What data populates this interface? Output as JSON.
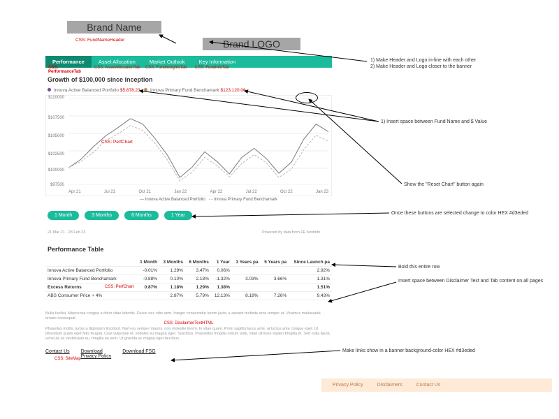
{
  "brand": {
    "name": "Brand Name",
    "logo": "Brand LOGO"
  },
  "css_labels": {
    "fundname": "CSS: FundNameHeader",
    "tab_perf": "CSS: PerformanceTab",
    "tab_asset": "CSS: AssetAllocationTab",
    "tab_market": "CSS: FundInsightsTab",
    "tab_key": "CSS: FundInfoTab",
    "perfchart": "CSS: PerfChart",
    "perfchart2": "CSS: PerfChart",
    "disclaimer": "CSS: DisclaimerTextHTML",
    "sitemap": "CSS: SiteMap"
  },
  "tabs": {
    "perf": "Performance",
    "asset": "Asset Allocation",
    "market": "Market Outlook",
    "key": "Key Information"
  },
  "chart_title": "Growth of $100,000 since inception",
  "legend": {
    "a": "Innova Active Balanced Portfolio",
    "b": "Innova Primary Fund Benchamark",
    "a_val": "$5,678.23",
    "b_val": "$123,120.06"
  },
  "chart_data": {
    "type": "line",
    "xlabel": "",
    "ylabel": "",
    "x_ticks": [
      "Apr 21",
      "Jul 21",
      "Oct 21",
      "Jan 22",
      "Apr 22",
      "Jul 22",
      "Oct 22",
      "Jan 23"
    ],
    "y_ticks": [
      "$110000",
      "$107500",
      "$105000",
      "$102500",
      "$100000",
      "$97500"
    ],
    "ylim": [
      97500,
      110000
    ],
    "series": [
      {
        "name": "Innova Active Balanced Portfolio",
        "color": "#7a7a7a",
        "values": [
          100000,
          101200,
          103000,
          104600,
          105800,
          107100,
          106300,
          104200,
          101800,
          98600,
          100100,
          102300,
          100900,
          99100,
          101500,
          102800,
          101300,
          99200,
          100800,
          104100,
          106300,
          105200
        ]
      },
      {
        "name": "Innova Primary Fund Benchamark",
        "color": "#c9b5a5",
        "values": [
          100000,
          100900,
          102200,
          103900,
          104900,
          106100,
          105400,
          103500,
          101100,
          98100,
          99400,
          101500,
          100300,
          98700,
          100600,
          101900,
          100700,
          98600,
          99800,
          102600,
          104700,
          103800
        ]
      }
    ]
  },
  "period_pills": [
    "1 Month",
    "3 Months",
    "6 Months",
    "1 Year"
  ],
  "powered": "Powered by data from FE fundinfo",
  "table_date": "21 Mar 21 - 28 Feb 23",
  "table_title": "Performance Table",
  "table": {
    "headers": [
      "",
      "1 Month",
      "3 Months",
      "6 Months",
      "1 Year",
      "3 Years pa",
      "5 Years pa",
      "Since Launch pa"
    ],
    "rows": [
      {
        "label": "Innova Active Balanced Portfolio",
        "v": [
          "-0.01%",
          "1.29%",
          "3.47%",
          "0.06%",
          "",
          "",
          "2.92%"
        ],
        "bold": false
      },
      {
        "label": "Innova Primary Fund Benchamark",
        "v": [
          "-0.88%",
          "0.10%",
          "2.18%",
          "-1.32%",
          "3.03%",
          "3.66%",
          "1.31%"
        ],
        "bold": false
      },
      {
        "label": "Excess Returns",
        "v": [
          "0.87%",
          "1.18%",
          "1.29%",
          "1.38%",
          "",
          "",
          "1.51%"
        ],
        "bold": true
      },
      {
        "label": "ABS Consumer Price + 4%",
        "v": [
          "",
          "2.87%",
          "5.79%",
          "12.13%",
          "8.18%",
          "7.26%",
          "9.43%"
        ],
        "bold": false
      }
    ]
  },
  "disclaimer": {
    "p1": "Nulla facilisi. Maecenas congue a dolor vitae lobortis. Fusce nec odio sem. Integer consectetur lorem justo, a aenard mobiste eros tempor ut. Vivamus malesuada ornare consequat.",
    "p2": "Phasellus mollis, turpis a dignissim tincidunt. Nam eu semper mauris, non molestie lorem. In vitae quam. Proin sagittis lacus ante, at luctus ante congue eget. Ut bibendum quam eget felis feugiat. Cras vulputate et, sodales eu magna eget. Suscibus. Praesellus fringilla rutrum ante, vitae ultricies sapien fringilla et. Sed nulla ligula, vehicula ac vestibulum eu, fringilla eu sem. Ut gravida ac magna eget faucibus."
  },
  "links": {
    "contact": "Contact Us",
    "download": "Download",
    "privacy": "Privacy Policy",
    "fsg": "Download FSG"
  },
  "footer": {
    "a": "Privacy Policy",
    "b": "Disclaimers",
    "c": "Contact Us"
  },
  "notes": {
    "hdr1": "1)    Make Header and Logo in-line with each other",
    "hdr2": "2)    Make Header and Logo closer to the banner",
    "spacer": "1)        Insert space between Fund Name and $ Value",
    "reset": "Show the \"Reset Chart\" button again",
    "pillcolor": "Once these buttons are selected change to color HEX #d3eded",
    "boldrow": "Bold this entire row",
    "discspace": "Insert space between Disclaimer Text and Tab content on all pages",
    "linksbanner": "Make links show in a banner background-color HEX #d3eded"
  }
}
